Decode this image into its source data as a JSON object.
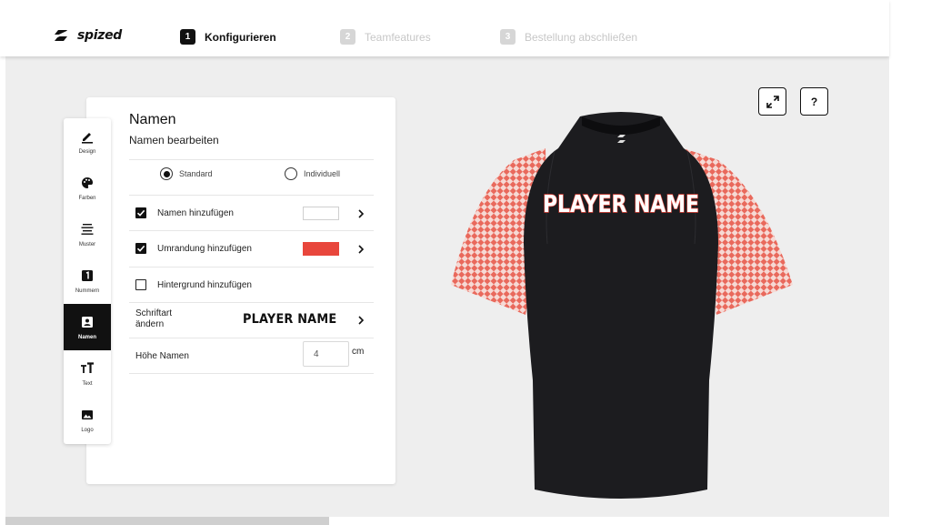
{
  "header": {
    "brand": "spized",
    "steps": [
      {
        "num": "1",
        "label": "Konfigurieren",
        "active": true
      },
      {
        "num": "2",
        "label": "Teamfeatures",
        "active": false
      },
      {
        "num": "3",
        "label": "Bestellung abschließen",
        "active": false
      }
    ]
  },
  "sidebar": {
    "items": [
      {
        "label": "Design",
        "icon": "pencil-icon"
      },
      {
        "label": "Farben",
        "icon": "palette-icon"
      },
      {
        "label": "Muster",
        "icon": "pattern-icon"
      },
      {
        "label": "Nummern",
        "icon": "number-icon"
      },
      {
        "label": "Namen",
        "icon": "name-badge-icon",
        "active": true
      },
      {
        "label": "Text",
        "icon": "text-size-icon"
      },
      {
        "label": "Logo",
        "icon": "image-icon"
      }
    ]
  },
  "panel": {
    "title": "Namen",
    "subtitle": "Namen bearbeiten",
    "mode_options": [
      {
        "label": "Standard",
        "selected": true
      },
      {
        "label": "Individuell",
        "selected": false
      }
    ],
    "add_names": {
      "label": "Namen hinzufügen",
      "checked": true,
      "color": "#ffffff"
    },
    "add_outline": {
      "label": "Umrandung hinzufügen",
      "checked": true,
      "color": "#e8463c"
    },
    "add_background": {
      "label": "Hintergrund hinzufügen",
      "checked": false
    },
    "font": {
      "label": "Schriftart ändern",
      "sample": "PLAYER NAME"
    },
    "height": {
      "label": "Höhe Namen",
      "value": "4",
      "unit": "cm"
    }
  },
  "preview": {
    "jersey_name": "PLAYER NAME",
    "body_color": "#1c1c1f",
    "sleeve_pattern_color": "#e9695c",
    "expand_icon": "expand-icon",
    "help_label": "?"
  }
}
